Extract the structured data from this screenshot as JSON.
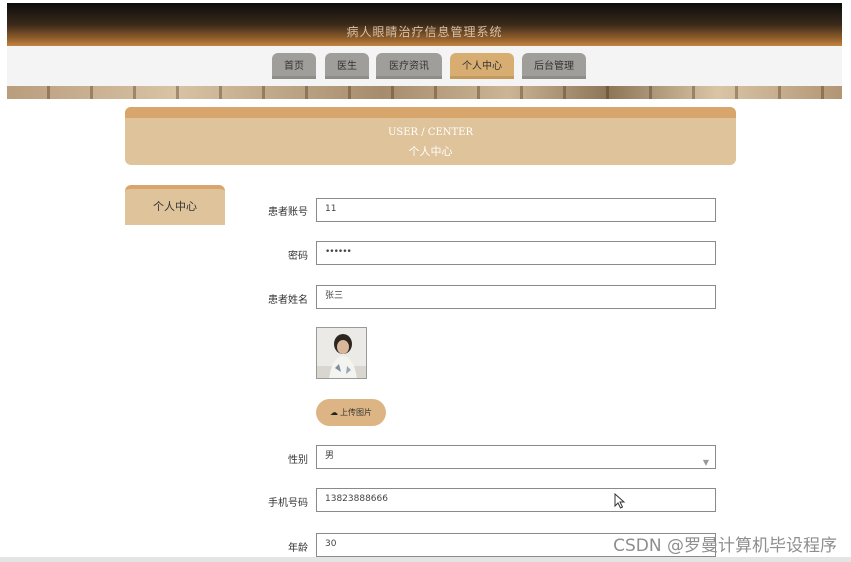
{
  "app": {
    "title": "病人眼睛治疗信息管理系统"
  },
  "nav": [
    {
      "label": "首页",
      "active": false
    },
    {
      "label": "医生",
      "active": false
    },
    {
      "label": "医疗资讯",
      "active": false
    },
    {
      "label": "个人中心",
      "active": true
    },
    {
      "label": "后台管理",
      "active": false
    }
  ],
  "header": {
    "subtitle_en": "USER / CENTER",
    "title_zh": "个人中心"
  },
  "sidebar": {
    "tab_label": "个人中心"
  },
  "form": {
    "account": {
      "label": "患者账号",
      "value": "11"
    },
    "password": {
      "label": "密码",
      "value": "••••••"
    },
    "name": {
      "label": "患者姓名",
      "value": "张三"
    },
    "upload": {
      "label": "上传图片",
      "icon": "cloud-upload-icon"
    },
    "gender": {
      "label": "性别",
      "value": "男"
    },
    "phone": {
      "label": "手机号码",
      "value": "13823888666"
    },
    "age": {
      "label": "年龄",
      "value": "30"
    }
  },
  "watermark": "CSDN @罗曼计算机毕设程序",
  "colors": {
    "accent": "#d8a66c",
    "card": "#dec39b",
    "nav_inactive": "#a09e9a"
  }
}
